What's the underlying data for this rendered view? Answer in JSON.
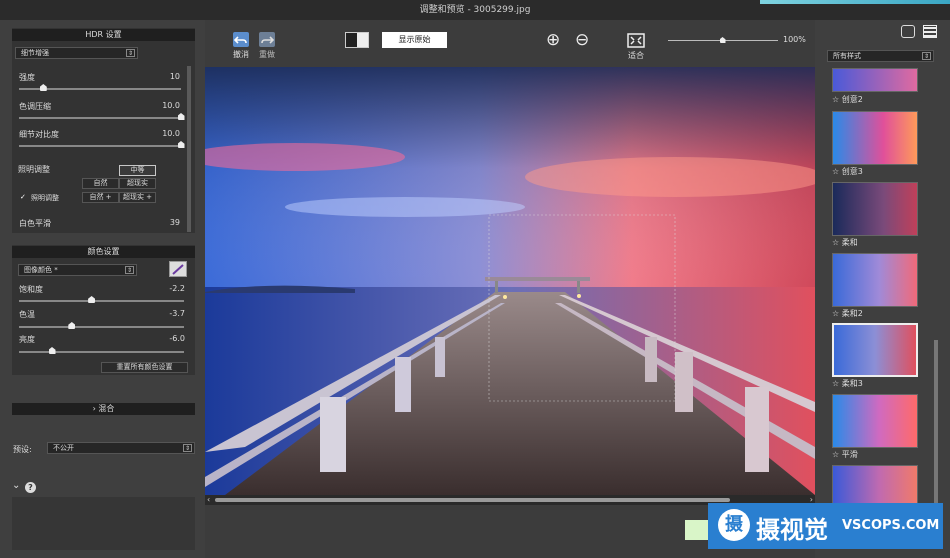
{
  "window": {
    "title": "调整和预览 - 3005299.jpg"
  },
  "hdr": {
    "header": "HDR 设置",
    "mode": "细节增强",
    "sliders": [
      {
        "label": "强度",
        "value": "10",
        "level": 0.15
      },
      {
        "label": "色调压缩",
        "value": "10.0",
        "level": 1.0
      },
      {
        "label": "细节对比度",
        "value": "10.0",
        "level": 1.0
      }
    ],
    "lighting": {
      "label": "照明调整",
      "mid_button": "中等",
      "natural": "自然",
      "surreal": "超现实",
      "natural_plus": "自然 +",
      "surreal_plus": "超现实 +",
      "smooth_label": "照明调整",
      "smooth_checked": true
    },
    "white_point": {
      "label": "白色平滑",
      "value": "39"
    }
  },
  "color": {
    "header": "颜色设置",
    "mode": "图像颜色 *",
    "sliders": [
      {
        "label": "饱和度",
        "value": "-2.2",
        "level": 0.44
      },
      {
        "label": "色温",
        "value": "-3.7",
        "level": 0.32
      },
      {
        "label": "亮度",
        "value": "-6.0",
        "level": 0.2
      }
    ],
    "reset": "重置所有颜色设置"
  },
  "blend": {
    "header": "混合"
  },
  "preset": {
    "label": "预设:",
    "value": "不公开"
  },
  "toolbar": {
    "undo": "撤消",
    "redo": "重做",
    "show_original": "显示原始",
    "fit": "适合",
    "zoom": "100%",
    "zoom_level": 0.5
  },
  "styles": {
    "dropdown": "所有样式",
    "items": [
      {
        "label": "创意2",
        "top": 0
      },
      {
        "label": "创意3"
      },
      {
        "label": "柔和"
      },
      {
        "label": "柔和2"
      },
      {
        "label": "柔和3",
        "selected": true
      },
      {
        "label": "平滑"
      }
    ]
  },
  "watermark": {
    "text": "摄视觉",
    "domain": "VSCOPS.COM"
  }
}
